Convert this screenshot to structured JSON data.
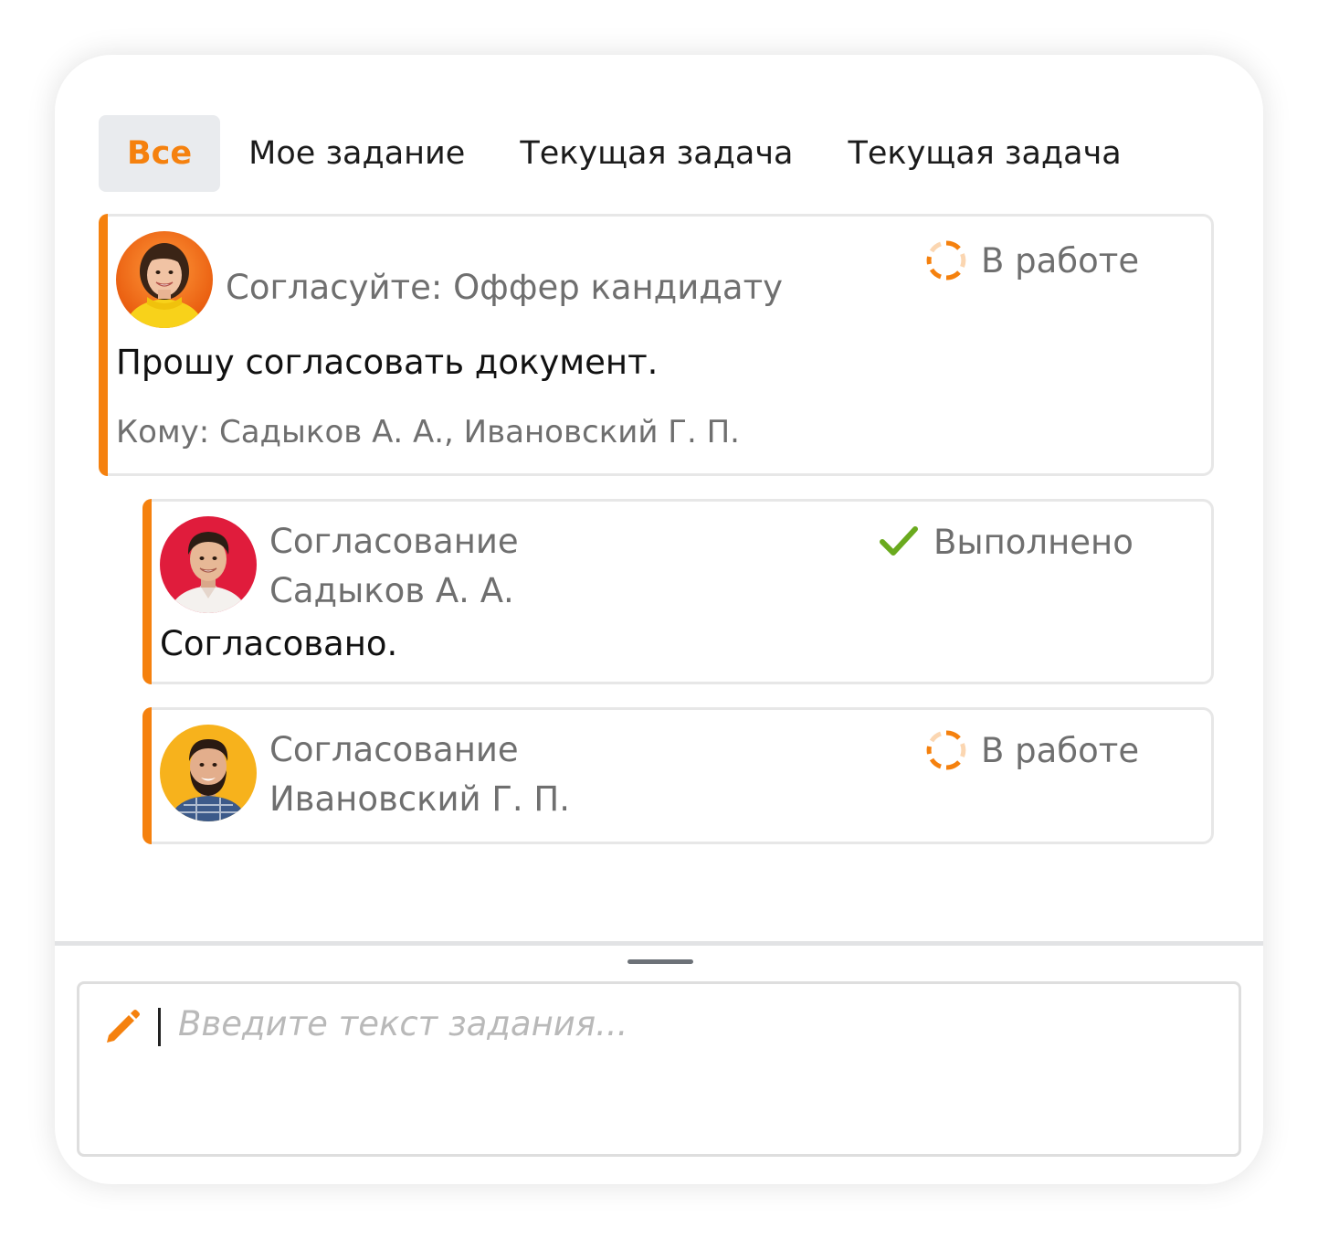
{
  "tabs": [
    {
      "label": "Все",
      "active": true
    },
    {
      "label": "Мое задание",
      "active": false
    },
    {
      "label": "Текущая задача",
      "active": false
    },
    {
      "label": "Текущая задача",
      "active": false
    }
  ],
  "tasks": [
    {
      "avatar_icon": "avatar-woman-icon",
      "title": "Согласуйте: Оффер кандидату",
      "status": "В работе",
      "status_icon": "in-progress-icon",
      "body": "Прошу согласовать документ.",
      "recipients": "Кому: Садыков А. А., Ивановский Г. П."
    },
    {
      "avatar_icon": "avatar-man-icon",
      "title_line1": "Согласование",
      "title_line2": "Садыков А. А.",
      "status": "Выполнено",
      "status_icon": "checkmark-icon",
      "body": "Согласовано."
    },
    {
      "avatar_icon": "avatar-bearded-man-icon",
      "title_line1": "Согласование",
      "title_line2": "Ивановский Г. П.",
      "status": "В работе",
      "status_icon": "in-progress-icon"
    }
  ],
  "composer": {
    "placeholder": "Введите текст задания...",
    "icon": "pencil-icon"
  },
  "colors": {
    "accent": "#f5810e",
    "done": "#6aaa1e",
    "tab_active_bg": "#e9ebee",
    "muted_text": "#6f6f6f"
  }
}
